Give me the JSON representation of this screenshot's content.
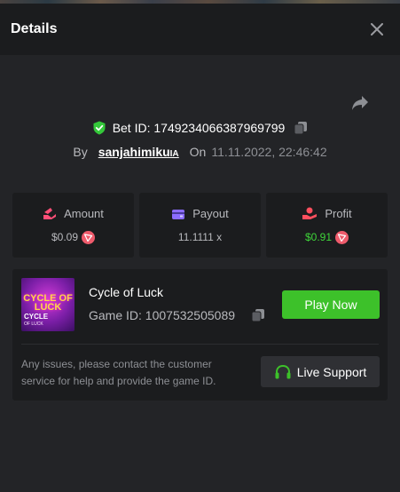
{
  "window": {
    "title": "Details"
  },
  "bet": {
    "id_text": "Bet ID: 1749234066387969799",
    "by_label": "By",
    "username": "sanjahimiku",
    "username_suffix": "IA",
    "on_label": "On",
    "datetime": "11.11.2022, 22:46:42"
  },
  "stats": [
    {
      "label": "Amount",
      "value": "$0.09",
      "icon": "amount-icon"
    },
    {
      "label": "Payout",
      "value": "11.1111 x",
      "icon": "wallet-icon"
    },
    {
      "label": "Profit",
      "value": "$0.91",
      "icon": "profit-icon"
    }
  ],
  "game": {
    "thumbnail_title": "CYCLE OF LUCK",
    "thumbnail_subtitle": "CYCLE",
    "thumbnail_caption": "OF LUCK",
    "thumbnail_brand": "CYCLE OF LUCK · EVOPLAY",
    "name": "Cycle of Luck",
    "id_text": "Game ID: 1007532505089",
    "play_label": "Play Now"
  },
  "support": {
    "message": "Any issues, please contact the customer service for help and provide the game ID.",
    "button_label": "Live Support"
  },
  "colors": {
    "background": "#232427",
    "panel": "#1b1c1e",
    "accent_green": "#3dc12a",
    "profit_green": "#3fd53a",
    "coin_red": "#ef5b6c",
    "icon_pink": "#ff4f77",
    "icon_purple": "#8b6cff",
    "icon_red": "#ff4f5e"
  }
}
